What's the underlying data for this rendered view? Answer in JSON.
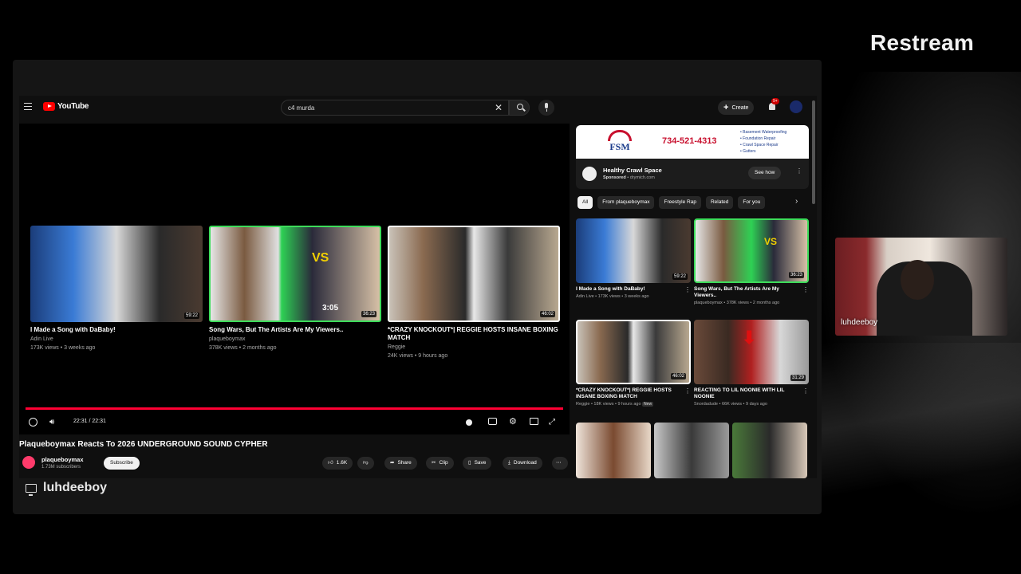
{
  "brand": "Restream",
  "streamer_name": "luhdeeboy",
  "youtube": {
    "logo_text": "YouTube",
    "search_query": "c4 murda",
    "create_label": "Create",
    "notification_count": "9+",
    "endscreen": [
      {
        "title": "I Made a Song with DaBaby!",
        "channel": "Adin Live",
        "meta": "173K views • 3 weeks ago",
        "duration": "59:22"
      },
      {
        "title": "Song Wars, But The Artists Are My Viewers..",
        "channel": "plaqueboymax",
        "meta": "378K views • 2 months ago",
        "duration": "36:23",
        "overlay_time": "3:05"
      },
      {
        "title": "*CRAZY KNOCKOUT*| REGGIE HOSTS INSANE BOXING MATCH",
        "channel": "Reggie",
        "meta": "24K views • 9 hours ago",
        "duration": "46:02"
      }
    ],
    "time": "22:31 / 22:31",
    "video_title": "Plaqueboymax Reacts To 2026 UNDERGROUND SOUND CYPHER",
    "channel_name": "plaqueboymax",
    "subscribers": "1.73M subscribers",
    "subscribe_label": "Subscribe",
    "likes": "1.6K",
    "actions": {
      "share": "Share",
      "clip": "Clip",
      "save": "Save",
      "download": "Download"
    },
    "ad": {
      "phone": "734-521-4313",
      "logo": "FSM",
      "bullets": [
        "• Basement Waterproofing",
        "• Foundation Repair",
        "• Crawl Space Repair",
        "• Gutters"
      ],
      "title": "Healthy Crawl Space",
      "sponsored": "Sponsored",
      "domain": "drymich.com",
      "cta": "See how"
    },
    "chips": [
      "All",
      "From plaqueboymax",
      "Freestyle Rap",
      "Related",
      "For you"
    ],
    "sidebar": [
      {
        "title": "I Made a Song with DaBaby!",
        "meta": "Adin Live • 173K views • 3 weeks ago",
        "duration": "59:22"
      },
      {
        "title": "Song Wars, But The Artists Are My Viewers..",
        "meta": "plaqueboymax • 378K views • 2 months ago",
        "duration": "36:23"
      },
      {
        "title": "*CRAZY KNOCKOUT*| REGGIE HOSTS INSANE BOXING MATCH",
        "meta": "Reggie • 18K views • 9 hours ago",
        "duration": "46:02",
        "badge": "New"
      },
      {
        "title": "REACTING TO LIL NOONIE WITH LIL NOONIE",
        "meta": "Snordadude • 66K views • 9 days ago",
        "duration": "31:29"
      }
    ]
  }
}
